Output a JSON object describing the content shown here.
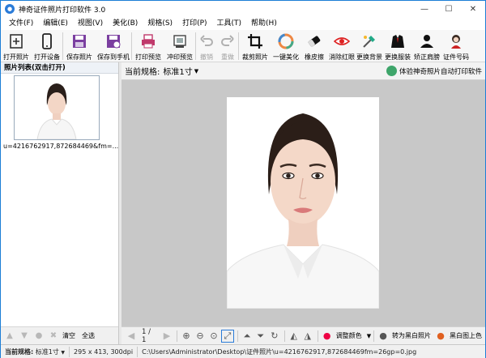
{
  "window": {
    "title": "神奇证件照片打印软件 3.0"
  },
  "menu": [
    "文件(F)",
    "编辑(E)",
    "视图(V)",
    "美化(B)",
    "规格(S)",
    "打印(P)",
    "工具(T)",
    "帮助(H)"
  ],
  "toolbar": [
    {
      "label": "打开照片",
      "icon": "open-photo-icon"
    },
    {
      "label": "打开设备",
      "icon": "phone-device-icon"
    },
    {
      "label": "保存照片",
      "icon": "save-icon"
    },
    {
      "label": "保存到手机",
      "icon": "save-to-phone-icon"
    },
    {
      "label": "打印预览",
      "icon": "printer-icon"
    },
    {
      "label": "冲印预览",
      "icon": "print-lab-icon"
    },
    {
      "label": "撤销",
      "icon": "undo-icon"
    },
    {
      "label": "重做",
      "icon": "redo-icon"
    },
    {
      "label": "裁剪照片",
      "icon": "crop-icon"
    },
    {
      "label": "一键美化",
      "icon": "beautify-icon"
    },
    {
      "label": "橡皮擦",
      "icon": "eraser-icon"
    },
    {
      "label": "消除红眼",
      "icon": "red-eye-icon"
    },
    {
      "label": "更换背景",
      "icon": "change-background-icon"
    },
    {
      "label": "更换服装",
      "icon": "change-clothes-icon"
    },
    {
      "label": "矫正肩膀",
      "icon": "shoulder-correct-icon"
    },
    {
      "label": "证件号码",
      "icon": "id-number-icon"
    }
  ],
  "left_panel": {
    "header": "照片列表(双击打开)",
    "thumbnail_caption": "u=4216762917,872684469&fm=...",
    "clear": "清空",
    "select_all": "全选"
  },
  "right_panel": {
    "spec_label": "当前规格:",
    "spec_value": "标准1寸",
    "promo": "体验神奇照片自动打印软件",
    "page": "1 / 1",
    "adjust_color": "调整颜色",
    "to_bw": "转为黑白照片",
    "bw_color": "黑白图上色"
  },
  "status": {
    "spec_label": "当前规格:",
    "spec_value": "标准1寸",
    "size": "295 x 413, 300dpi",
    "path": "C:\\Users\\Administrator\\Desktop\\证件照片\\u=4216762917,872684469fm=26gp=0.jpg"
  },
  "colors": {
    "accent": "#1c7ed6",
    "canvas_bg": "#c8c8c8"
  }
}
